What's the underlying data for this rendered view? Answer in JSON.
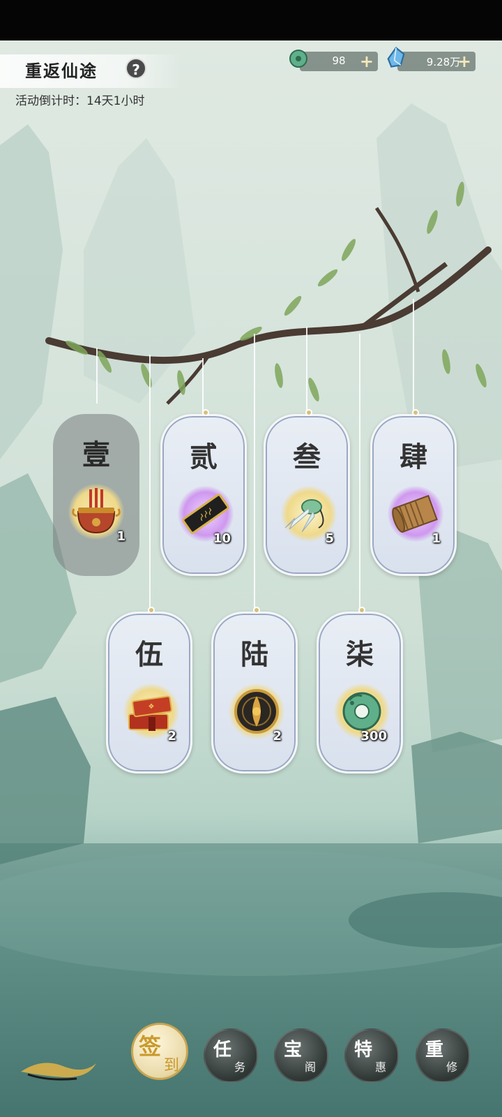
{
  "header": {
    "title": "重返仙途",
    "help_label": "?",
    "countdown": "活动倒计时：14天1小时"
  },
  "resources": [
    {
      "icon": "jade-ring-icon",
      "value": "98"
    },
    {
      "icon": "spirit-crystal-icon",
      "value": "9.28万"
    }
  ],
  "plus_label": "+",
  "tags": [
    {
      "label": "壹",
      "item": "incense-burner-icon",
      "count": "1",
      "claimed": true,
      "glow": "#f2e3a0"
    },
    {
      "label": "贰",
      "item": "token-plaque-icon",
      "count": "10",
      "claimed": false,
      "glow": "#d8a8f0"
    },
    {
      "label": "叁",
      "item": "jade-cicada-icon",
      "count": "5",
      "claimed": false,
      "glow": "#f4e7a8"
    },
    {
      "label": "肆",
      "item": "bamboo-scroll-icon",
      "count": "1",
      "claimed": false,
      "glow": "#d8a8f0"
    },
    {
      "label": "伍",
      "item": "treasure-books-icon",
      "count": "2",
      "claimed": false,
      "glow": "#f4e7a8"
    },
    {
      "label": "陆",
      "item": "bronze-medallion-icon",
      "count": "2",
      "claimed": false,
      "glow": "#f4e7a8"
    },
    {
      "label": "柒",
      "item": "jade-dragon-ring-icon",
      "count": "300",
      "claimed": false,
      "glow": "#f4e7a8"
    }
  ],
  "nav": [
    {
      "c1": "签",
      "c2": "到",
      "active": true
    },
    {
      "c1": "任",
      "c2": "务",
      "active": false
    },
    {
      "c1": "宝",
      "c2": "阁",
      "active": false
    },
    {
      "c1": "特",
      "c2": "惠",
      "active": false
    },
    {
      "c1": "重",
      "c2": "修",
      "active": false
    }
  ]
}
